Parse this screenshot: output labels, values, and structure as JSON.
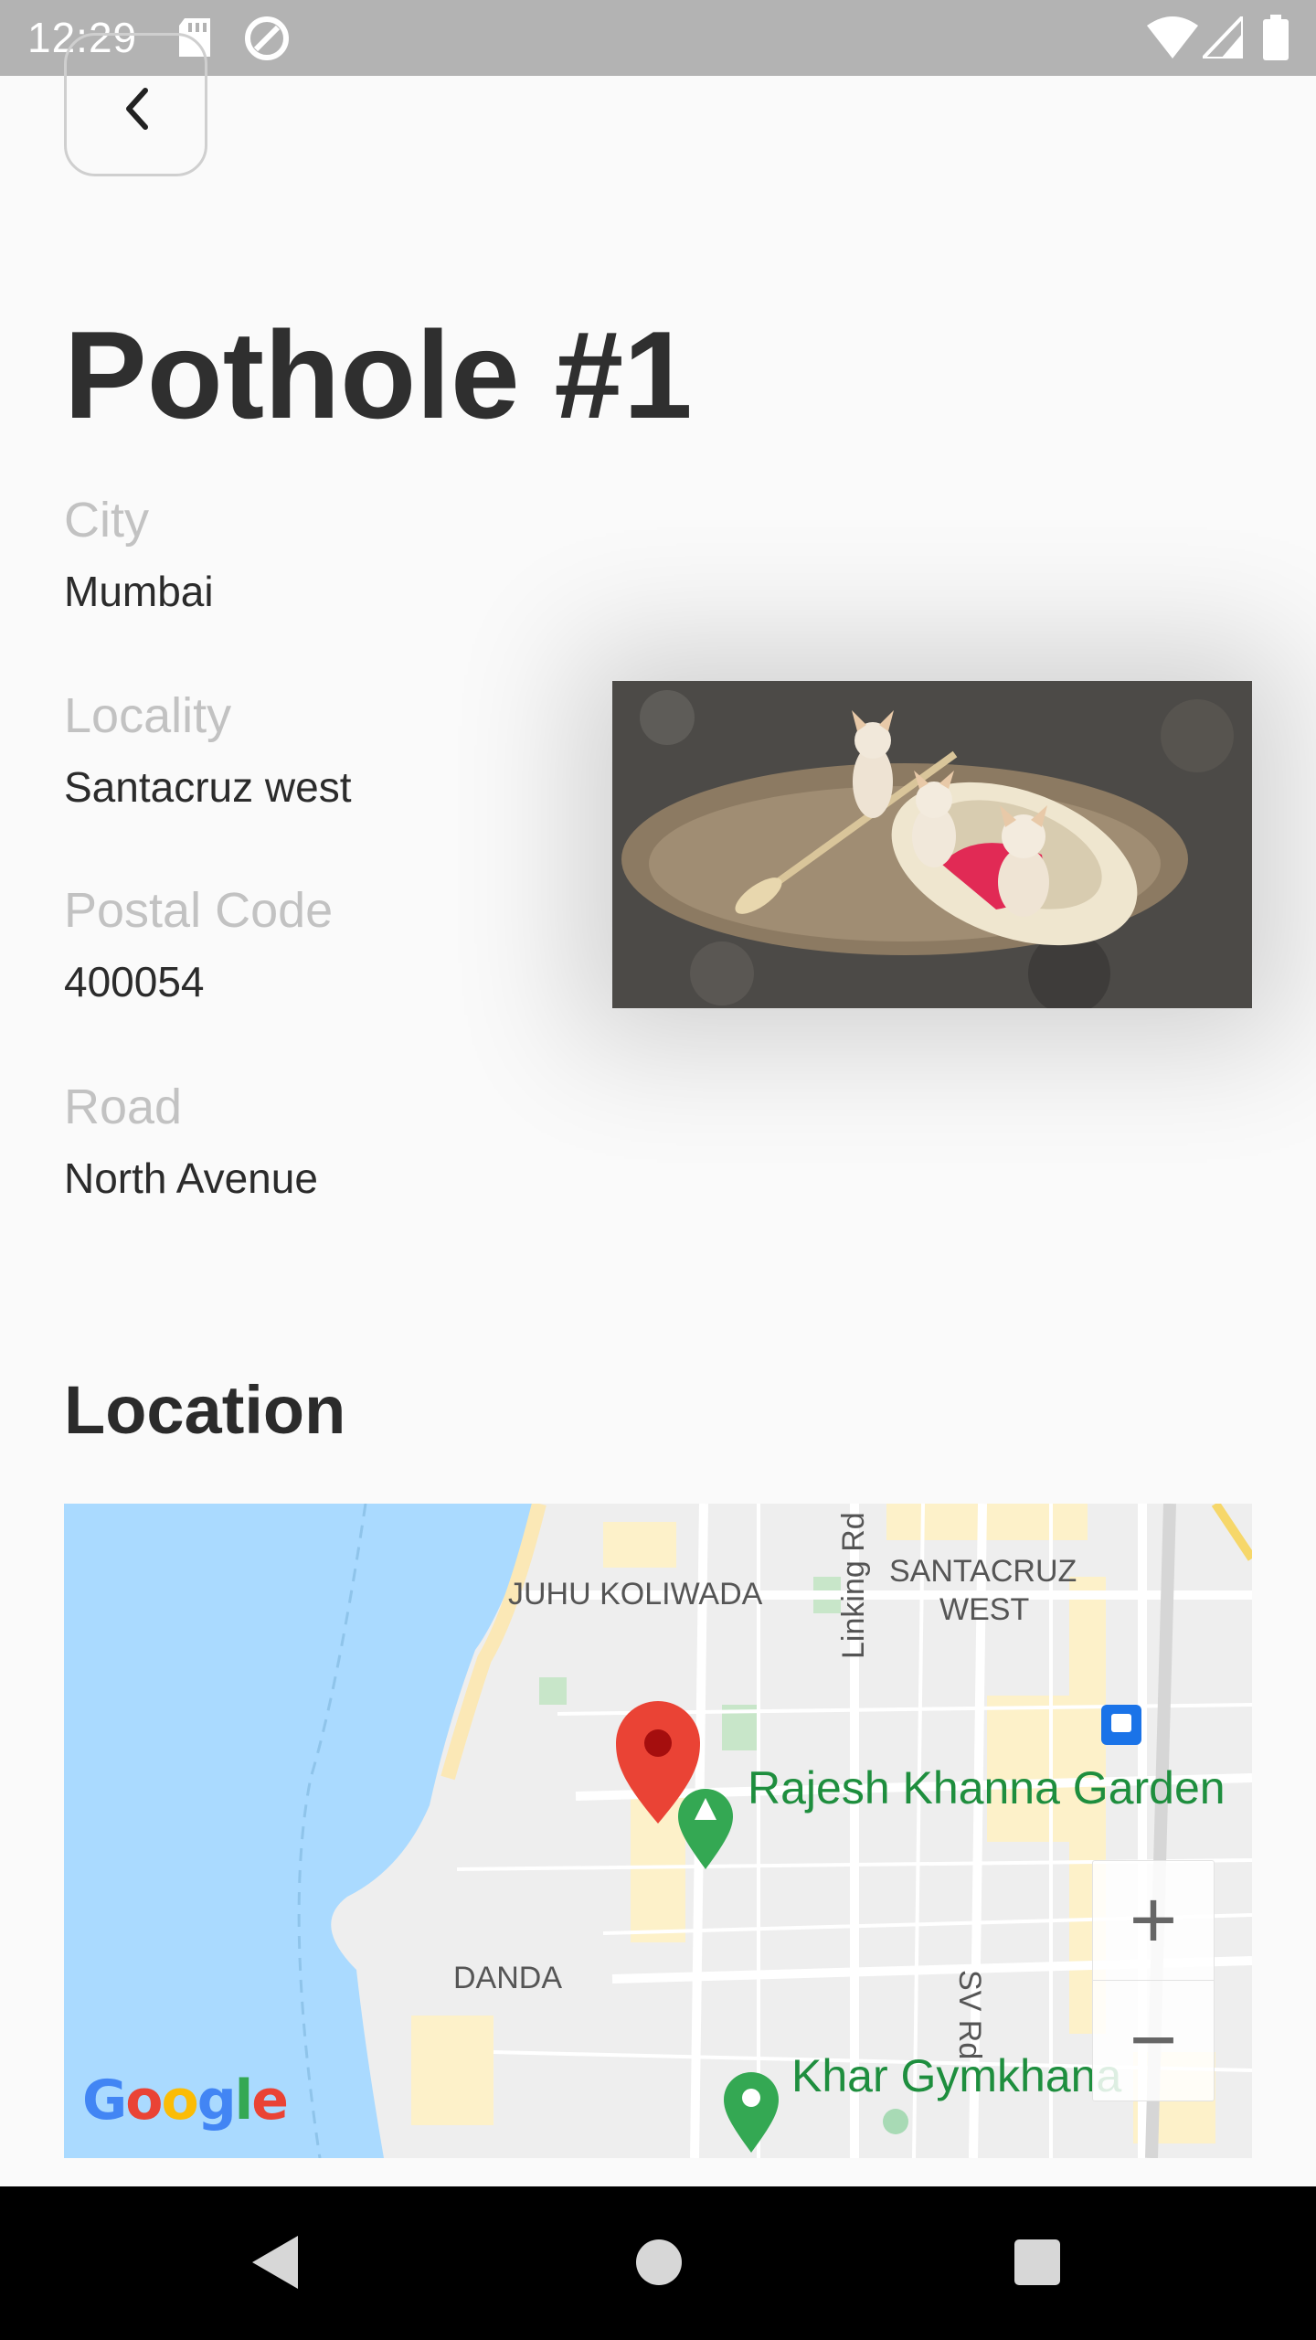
{
  "status_bar": {
    "time": "12:29",
    "icons": [
      "sd-card-icon",
      "sync-icon",
      "wifi-icon",
      "signal-icon",
      "battery-icon"
    ]
  },
  "header": {
    "back_icon": "chevron-left-icon",
    "title": "Pothole #1"
  },
  "details": {
    "fields": [
      {
        "label": "City",
        "value": "Mumbai"
      },
      {
        "label": "Locality",
        "value": "Santacruz west"
      },
      {
        "label": "Postal Code",
        "value": "400054"
      },
      {
        "label": "Road",
        "value": "North Avenue"
      }
    ]
  },
  "photo": {
    "description": "three dogs in a bed floating in a pothole"
  },
  "location": {
    "title": "Location",
    "map": {
      "labels": {
        "juhu": "JUHU KOLIWADA",
        "santacruz_1": "SANTACRUZ",
        "santacruz_2": "WEST",
        "linking_rd": "Linking Rd",
        "rajesh": "Rajesh Khanna Garden",
        "danda": "DANDA",
        "sv_rd": "SV Rd",
        "khar": "Khar Gymkhana"
      },
      "zoom_in": "+",
      "zoom_out": "−",
      "provider": "Google",
      "colors": {
        "water": "#aadaff",
        "land": "#eeeeee",
        "pin": "#ea4335",
        "park": "#34a853"
      }
    }
  },
  "nav_bar": {
    "icons": [
      "back-triangle-icon",
      "home-circle-icon",
      "recents-square-icon"
    ]
  }
}
